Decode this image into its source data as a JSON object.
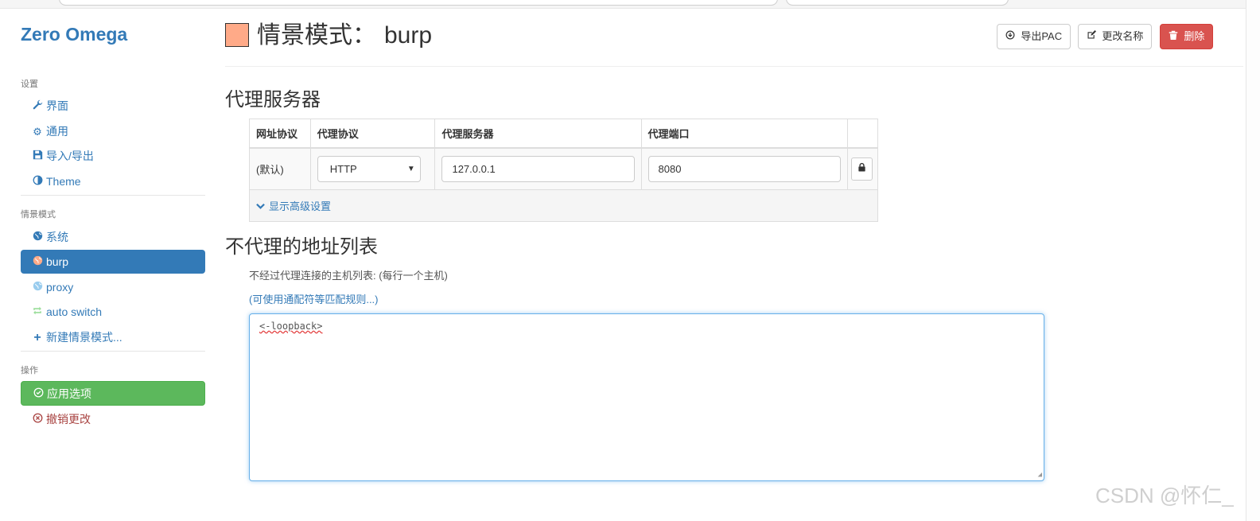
{
  "sidebar": {
    "brand": "Zero Omega",
    "settings_header": "设置",
    "settings_items": [
      {
        "label": "界面",
        "icon": "wrench-icon"
      },
      {
        "label": "通用",
        "icon": "gear-icon"
      },
      {
        "label": "导入/导出",
        "icon": "floppy-icon"
      },
      {
        "label": "Theme",
        "icon": "contrast-icon"
      }
    ],
    "profiles_header": "情景模式",
    "profiles": [
      {
        "label": "系统",
        "icon": "globe-icon",
        "color": "#337ab7"
      },
      {
        "label": "burp",
        "icon": "globe-icon",
        "color": "#ffaa88",
        "active": true
      },
      {
        "label": "proxy",
        "icon": "globe-icon",
        "color": "#99ccee"
      },
      {
        "label": "auto switch",
        "icon": "switch-arrows-icon",
        "color": "#99dd99"
      },
      {
        "label": "新建情景模式...",
        "icon": "plus-icon"
      }
    ],
    "actions_header": "操作",
    "apply_label": "应用选项",
    "discard_label": "撤销更改"
  },
  "profile": {
    "title_prefix": "情景模式：",
    "name": "burp",
    "color": "#ffaa88",
    "export_pac_label": "导出PAC",
    "rename_label": "更改名称",
    "delete_label": "删除"
  },
  "proxy_servers": {
    "heading": "代理服务器",
    "columns": [
      "网址协议",
      "代理协议",
      "代理服务器",
      "代理端口"
    ],
    "row": {
      "scheme": "(默认)",
      "protocol": "HTTP",
      "server": "127.0.0.1",
      "port": "8080"
    },
    "advanced_label": "显示高级设置"
  },
  "bypass": {
    "heading": "不代理的地址列表",
    "help": "不经过代理连接的主机列表: (每行一个主机)",
    "link": "(可使用通配符等匹配规则...)",
    "value": "<-loopback>"
  },
  "watermark": "CSDN @怀仁_"
}
